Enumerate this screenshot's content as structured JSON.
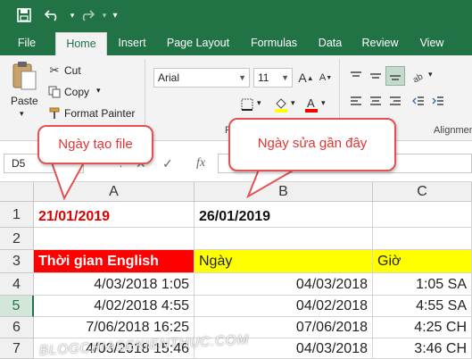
{
  "colors": {
    "excel_green": "#217346",
    "header_red": "#ff0000",
    "header_yellow": "#ffff00",
    "callout_red": "#e53333"
  },
  "quick_access": {
    "icons": [
      "save-icon",
      "undo-icon",
      "redo-icon",
      "customize-icon"
    ]
  },
  "tabs": [
    "File",
    "Home",
    "Insert",
    "Page Layout",
    "Formulas",
    "Data",
    "Review",
    "View"
  ],
  "active_tab": "Home",
  "ribbon": {
    "paste_label": "Paste",
    "cut_label": "Cut",
    "copy_label": "Copy",
    "format_painter_label": "Format Painter",
    "font_name": "Arial",
    "font_size": "11",
    "group_font_letter": "F",
    "alignment_group_label": "Alignment"
  },
  "formula_bar": {
    "name_box": "D5",
    "fx_label": "fx",
    "formula": ""
  },
  "sheet": {
    "columns": [
      "A",
      "B",
      "C"
    ],
    "rows": [
      "1",
      "2",
      "3",
      "4",
      "5",
      "6",
      "7"
    ],
    "selected_row": "5",
    "cells": {
      "A1": "21/01/2019",
      "B1": "26/01/2019",
      "A3": "Thời gian English",
      "B3": "Ngày",
      "C3": "Giờ",
      "A4": "4/03/2018 1:05",
      "B4": "04/03/2018",
      "C4": "1:05 SA",
      "A5": "4/02/2018 4:55",
      "B5": "04/02/2018",
      "C5": "4:55 SA",
      "A6": "7/06/2018 16:25",
      "B6": "07/06/2018",
      "C6": "4:25 CH",
      "A7": "4/03/2018 15:46",
      "B7": "04/03/2018",
      "C7": "3:46 CH"
    }
  },
  "callouts": {
    "left": "Ngày tạo file",
    "right": "Ngày sửa gần đây"
  },
  "watermark": "BLOGCHIASEKIENTHUC.COM"
}
